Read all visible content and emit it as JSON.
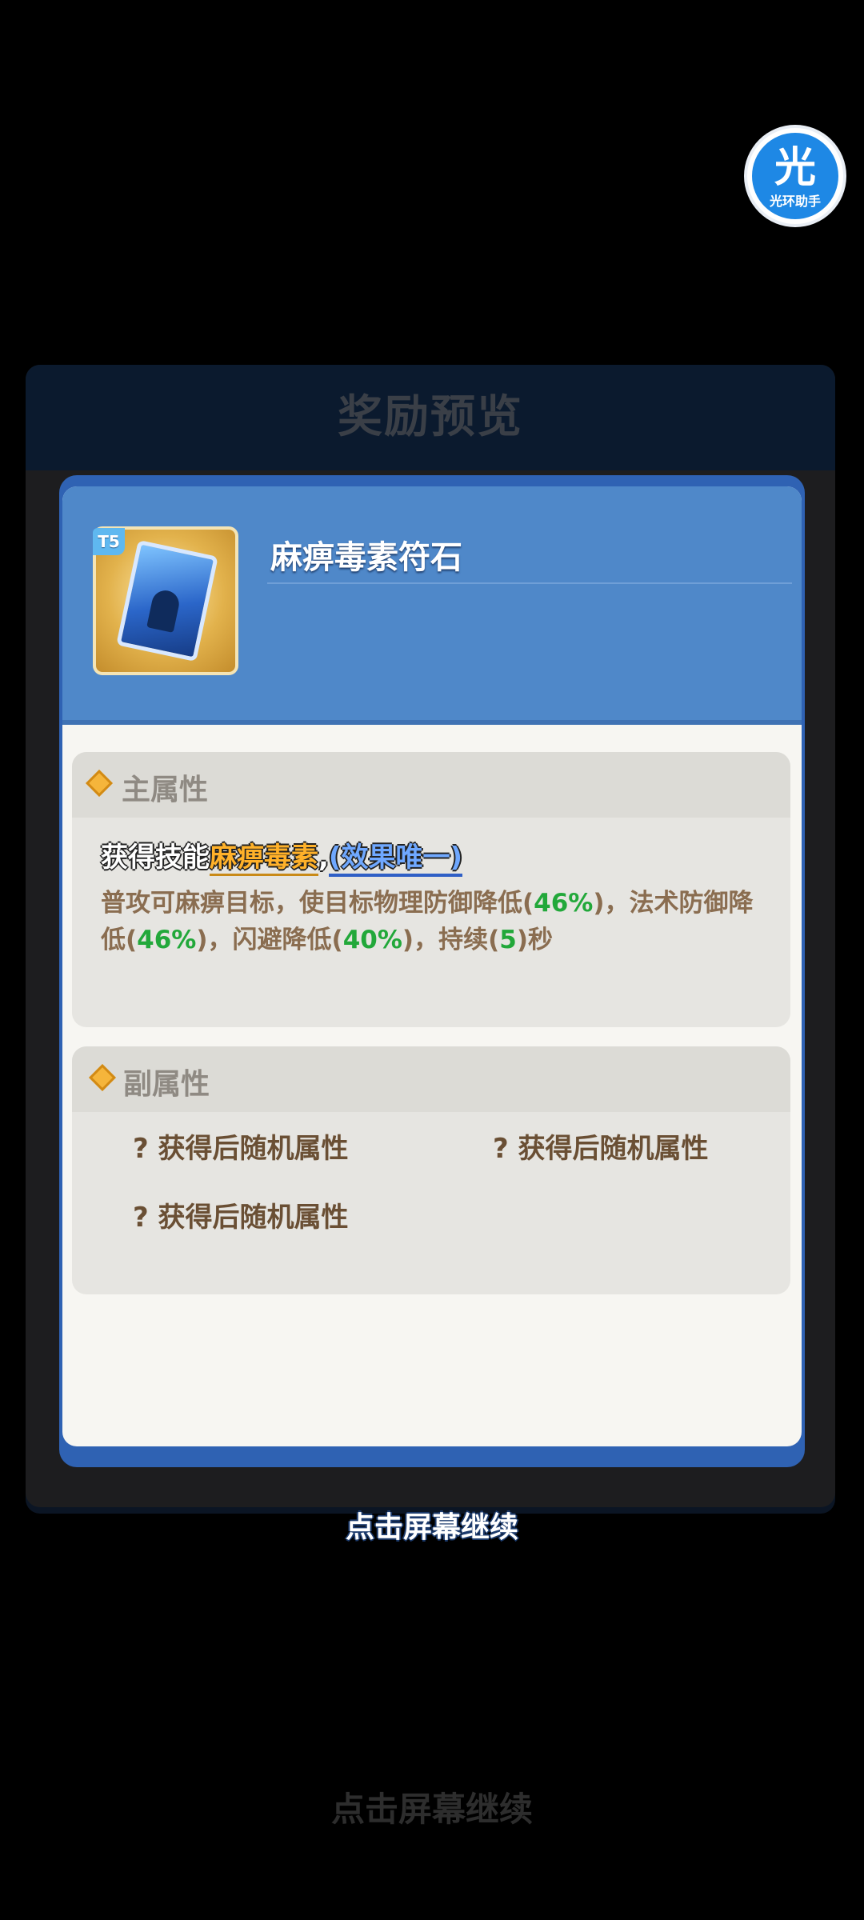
{
  "helper_badge": {
    "glyph": "光",
    "label": "光环助手"
  },
  "background": {
    "dialog_title": "奖励预览",
    "bottom_text": "点击屏幕继续"
  },
  "item": {
    "tier": "T5",
    "name": "麻痹毒素符石"
  },
  "main_attr": {
    "title": "主属性",
    "skill_prefix": "获得技能",
    "skill_name": "麻痹毒素",
    "separator": ",",
    "unique_tag": "(效果唯一)",
    "description": {
      "p1": "普攻可麻痹目标，使目标物理防御降低(",
      "v1": "46%",
      "p2": ")，法术防御降低(",
      "v2": "46%",
      "p3": ")，闪避降低(",
      "v3": "40%",
      "p4": ")，持续(",
      "v4": "5",
      "p5": ")秒"
    }
  },
  "sub_attr": {
    "title": "副属性",
    "items": [
      "? 获得后随机属性",
      "? 获得后随机属性",
      "? 获得后随机属性"
    ]
  },
  "continue_text": "点击屏幕继续",
  "colors": {
    "card_header": "#4f88c9",
    "card_border": "#2f62b3",
    "skill_name": "#ffb129",
    "unique_tag": "#6fa8ff",
    "value_green": "#22a83a",
    "diamond": "#f5b53b"
  }
}
